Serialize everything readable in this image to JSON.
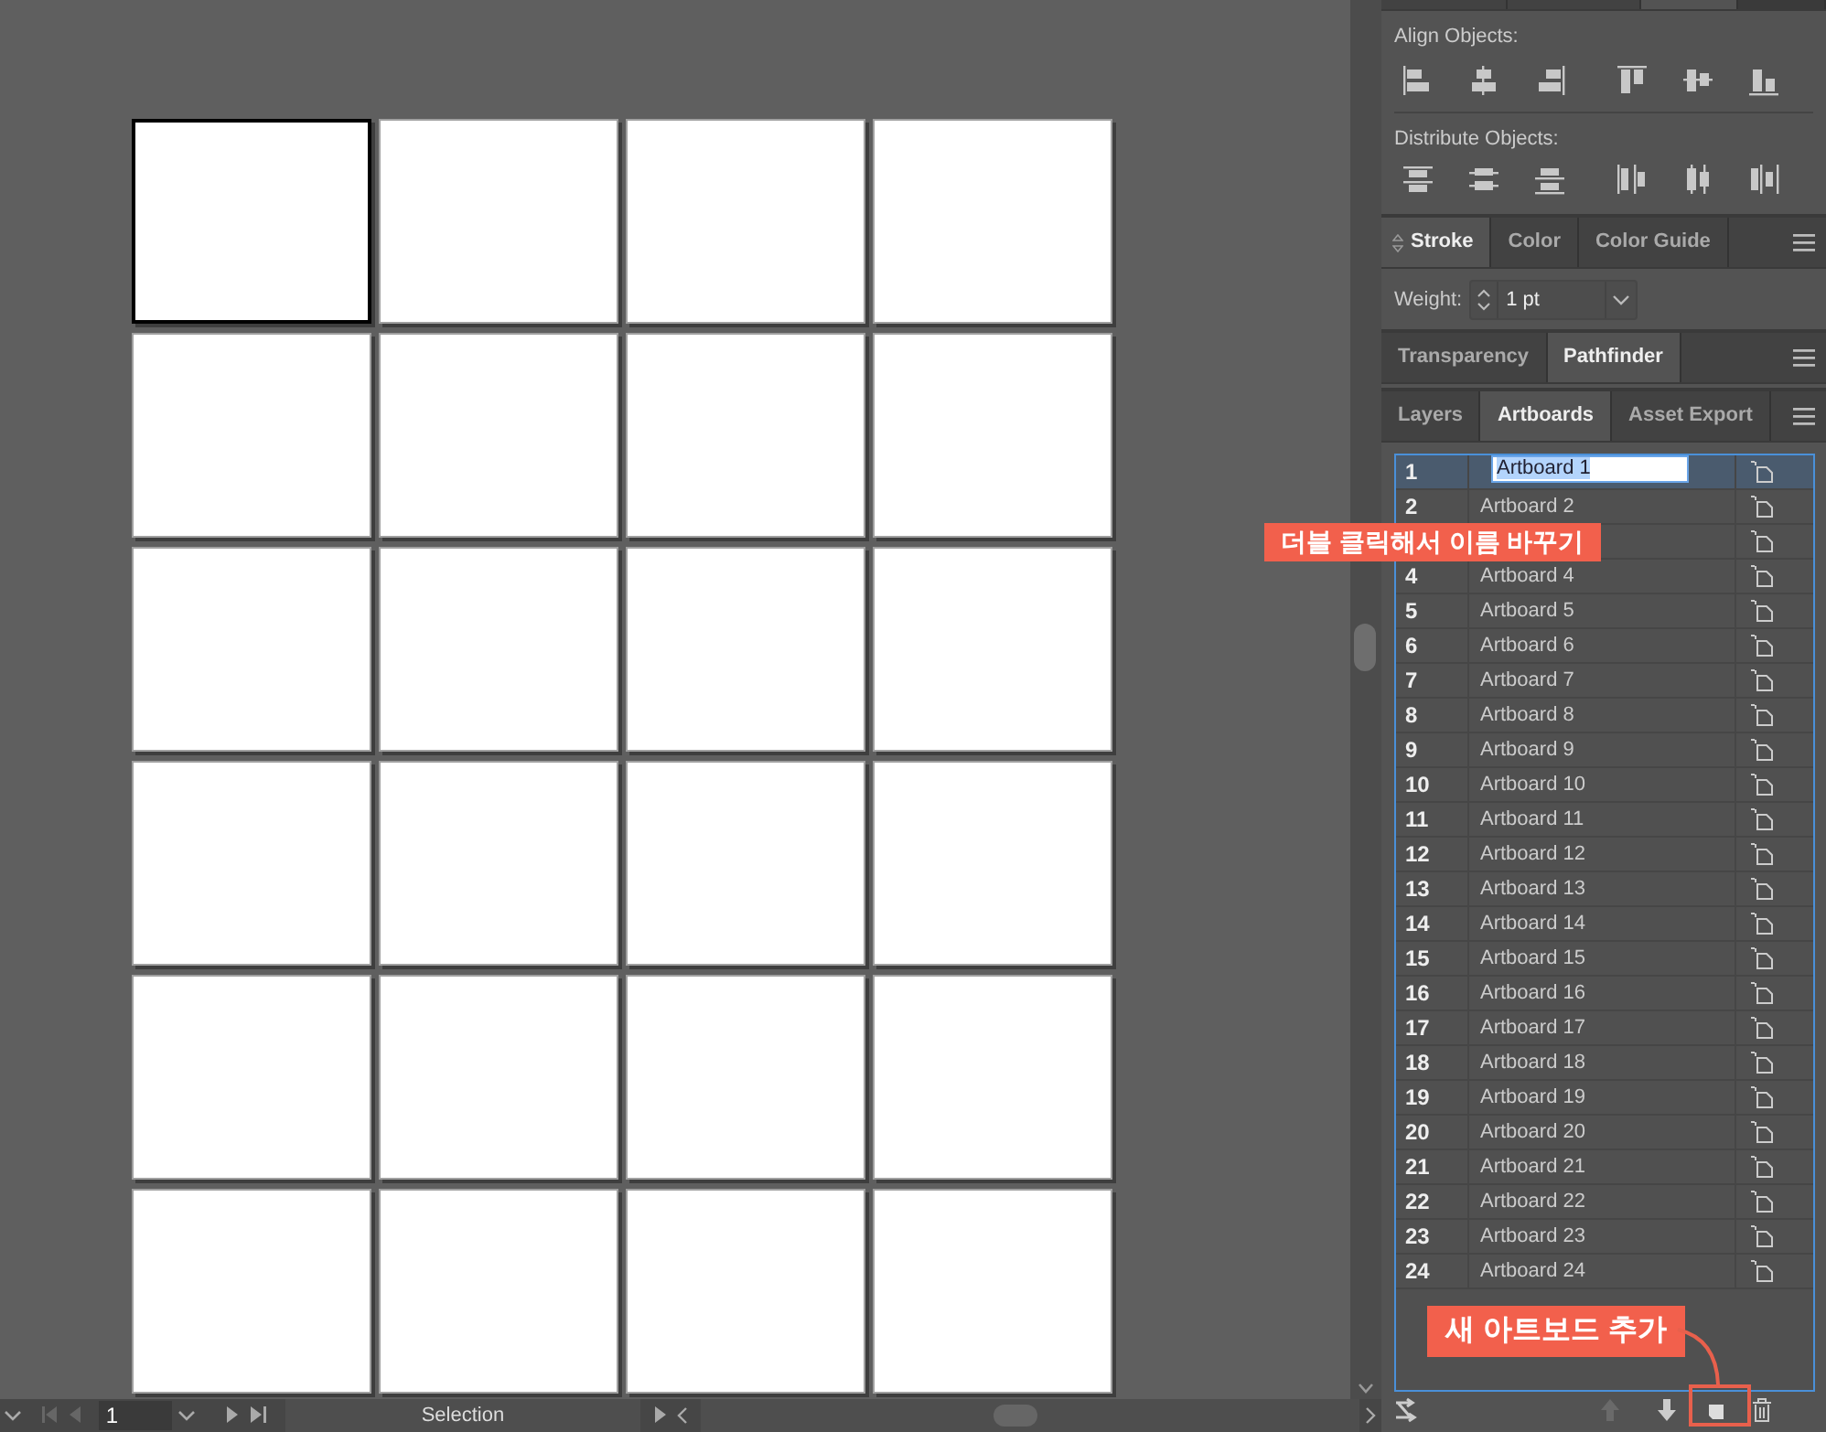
{
  "canvas": {
    "artboards": [
      {
        "selected": true
      },
      {
        "selected": false
      },
      {
        "selected": false
      },
      {
        "selected": false
      },
      {
        "selected": false
      },
      {
        "selected": false
      },
      {
        "selected": false
      },
      {
        "selected": false
      },
      {
        "selected": false
      },
      {
        "selected": false
      },
      {
        "selected": false
      },
      {
        "selected": false
      },
      {
        "selected": false
      },
      {
        "selected": false
      },
      {
        "selected": false
      },
      {
        "selected": false
      },
      {
        "selected": false
      },
      {
        "selected": false
      },
      {
        "selected": false
      },
      {
        "selected": false
      },
      {
        "selected": false
      },
      {
        "selected": false
      },
      {
        "selected": false
      },
      {
        "selected": false
      }
    ]
  },
  "status_bar": {
    "page": "1",
    "tool": "Selection"
  },
  "align_panel": {
    "align_label": "Align Objects:",
    "distribute_label": "Distribute Objects:"
  },
  "stroke_panel": {
    "tabs": [
      {
        "label": "Stroke",
        "selected": true
      },
      {
        "label": "Color",
        "selected": false
      },
      {
        "label": "Color Guide",
        "selected": false
      }
    ],
    "weight_label": "Weight:",
    "weight_value": "1 pt"
  },
  "pathfinder_panel": {
    "tabs": [
      {
        "label": "Transparency",
        "selected": false
      },
      {
        "label": "Pathfinder",
        "selected": true
      }
    ]
  },
  "artboards_panel": {
    "tabs": [
      {
        "label": "Layers",
        "selected": false
      },
      {
        "label": "Artboards",
        "selected": true
      },
      {
        "label": "Asset Export",
        "selected": false
      }
    ],
    "rows": [
      {
        "kind": "editing",
        "number": "1",
        "name": "Artboard 1",
        "selected": true
      },
      {
        "kind": "plain",
        "number": "2",
        "name": "Artboard 2",
        "selected": false
      },
      {
        "selected": false
      },
      {
        "kind": "plain",
        "number": "4",
        "name": "Artboard 4",
        "selected": false
      },
      {
        "kind": "plain",
        "number": "5",
        "name": "Artboard 5",
        "selected": false
      },
      {
        "kind": "plain",
        "number": "6",
        "name": "Artboard 6",
        "selected": false
      },
      {
        "kind": "plain",
        "number": "7",
        "name": "Artboard 7",
        "selected": false
      },
      {
        "kind": "plain",
        "number": "8",
        "name": "Artboard 8",
        "selected": false
      },
      {
        "kind": "plain",
        "number": "9",
        "name": "Artboard 9",
        "selected": false
      },
      {
        "kind": "plain",
        "number": "10",
        "name": "Artboard 10",
        "selected": false
      },
      {
        "kind": "plain",
        "number": "11",
        "name": "Artboard 11",
        "selected": false
      },
      {
        "kind": "plain",
        "number": "12",
        "name": "Artboard 12",
        "selected": false
      },
      {
        "kind": "plain",
        "number": "13",
        "name": "Artboard 13",
        "selected": false
      },
      {
        "kind": "plain",
        "number": "14",
        "name": "Artboard 14",
        "selected": false
      },
      {
        "kind": "plain",
        "number": "15",
        "name": "Artboard 15",
        "selected": false
      },
      {
        "kind": "plain",
        "number": "16",
        "name": "Artboard 16",
        "selected": false
      },
      {
        "kind": "plain",
        "number": "17",
        "name": "Artboard 17",
        "selected": false
      },
      {
        "kind": "plain",
        "number": "18",
        "name": "Artboard 18",
        "selected": false
      },
      {
        "kind": "plain",
        "number": "19",
        "name": "Artboard 19",
        "selected": false
      },
      {
        "kind": "plain",
        "number": "20",
        "name": "Artboard 20",
        "selected": false
      },
      {
        "kind": "plain",
        "number": "21",
        "name": "Artboard 21",
        "selected": false
      },
      {
        "kind": "plain",
        "number": "22",
        "name": "Artboard 22",
        "selected": false
      },
      {
        "kind": "plain",
        "number": "23",
        "name": "Artboard 23",
        "selected": false
      },
      {
        "kind": "plain",
        "number": "24",
        "name": "Artboard 24",
        "selected": false
      }
    ]
  },
  "callouts": [
    {
      "kind": "rename",
      "text": "더블 클릭해서 이름 바꾸기"
    },
    {
      "kind": "add",
      "text": "새 아트보드 추가"
    }
  ]
}
